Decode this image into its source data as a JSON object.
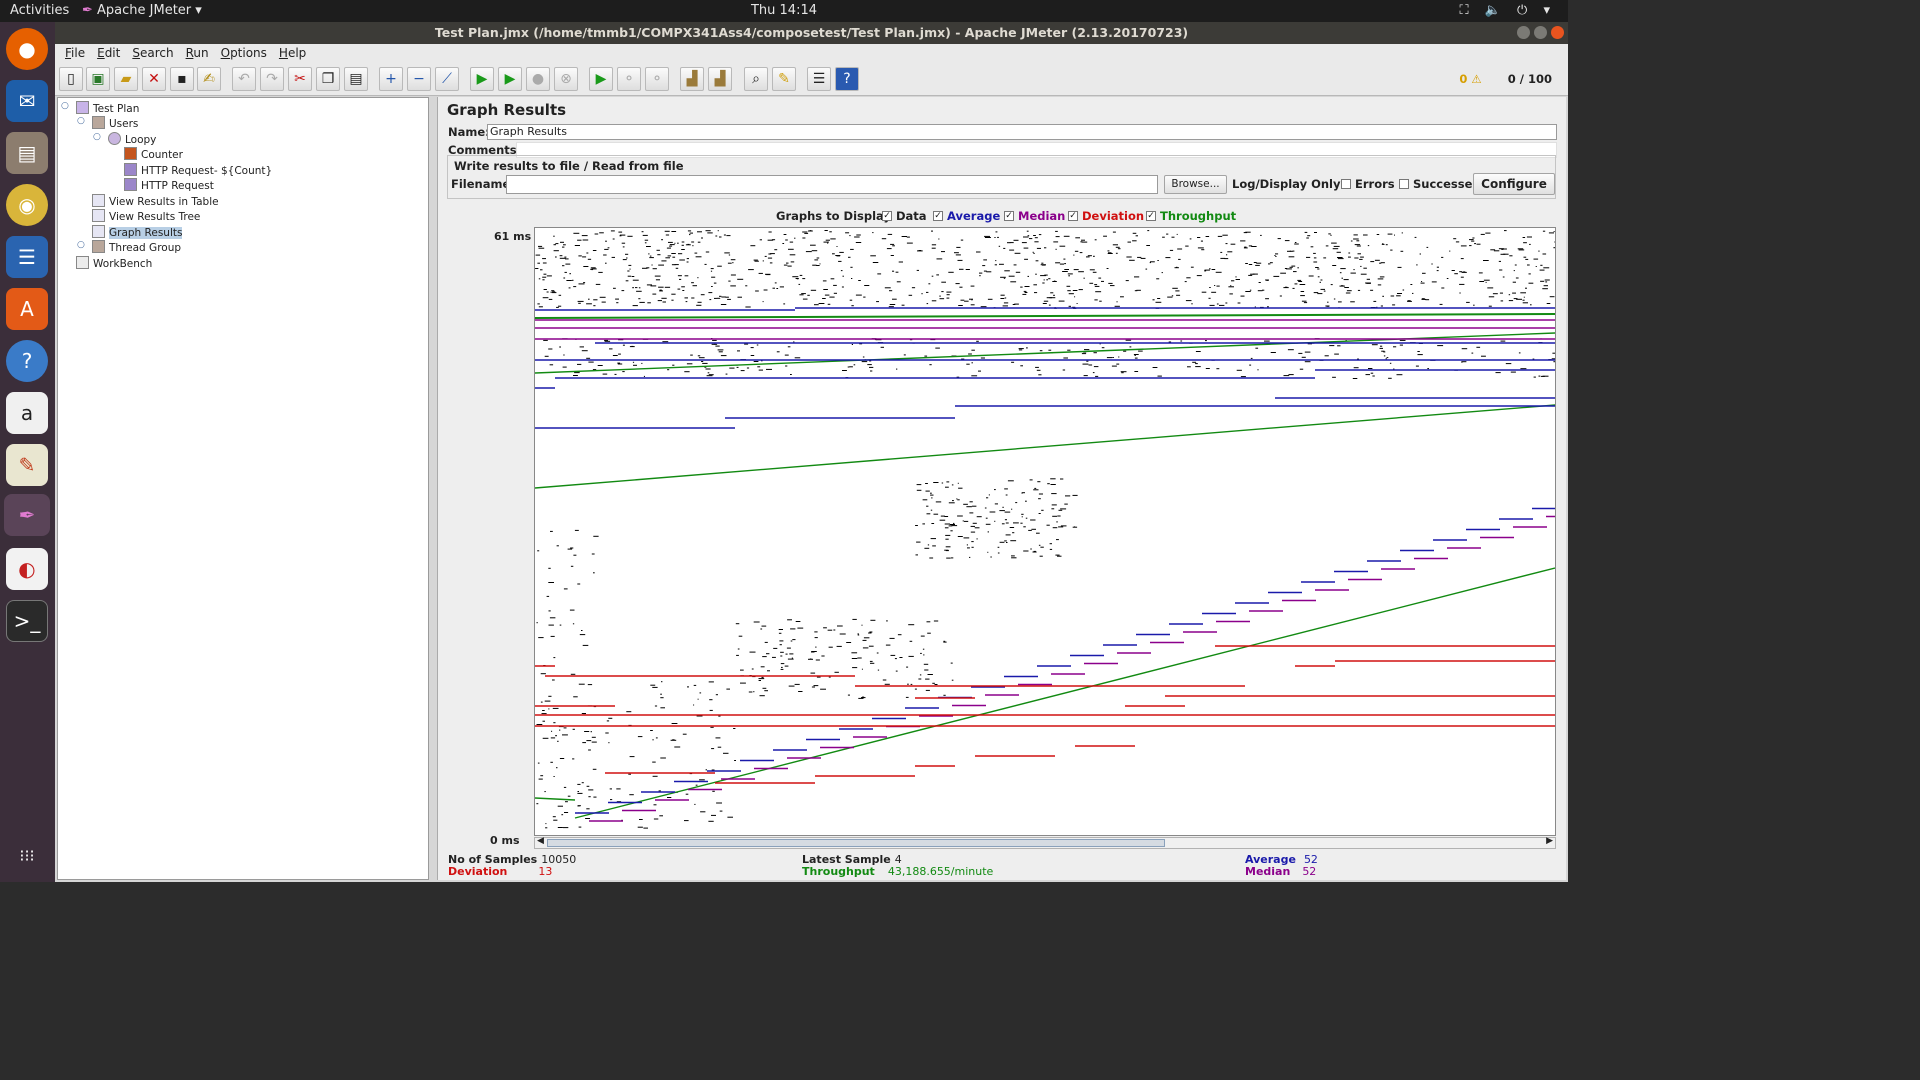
{
  "desktop": {
    "activities": "Activities",
    "app_menu": "Apache JMeter",
    "clock": "Thu 14:14",
    "tray": "⛶ 🔈 ⏻"
  },
  "window": {
    "title": "Test Plan.jmx (/home/tmmb1/COMPX341Ass4/composetest/Test Plan.jmx) - Apache JMeter (2.13.20170723)"
  },
  "menu": [
    "File",
    "Edit",
    "Search",
    "Run",
    "Options",
    "Help"
  ],
  "toolbar": {
    "warnings": "0 ⚠",
    "threads": "0 / 100"
  },
  "tree": [
    {
      "label": "Test Plan",
      "depth": 0
    },
    {
      "label": "Users",
      "depth": 1
    },
    {
      "label": "Loopy",
      "depth": 2
    },
    {
      "label": "Counter",
      "depth": 3
    },
    {
      "label": "HTTP Request- ${Count}",
      "depth": 3
    },
    {
      "label": "HTTP Request",
      "depth": 3
    },
    {
      "label": "View Results in Table",
      "depth": 1
    },
    {
      "label": "View Results Tree",
      "depth": 1
    },
    {
      "label": "Graph Results",
      "depth": 1,
      "selected": true
    },
    {
      "label": "Thread Group",
      "depth": 1
    },
    {
      "label": "WorkBench",
      "depth": 0
    }
  ],
  "panel": {
    "title": "Graph Results",
    "name_label": "Name:",
    "name_value": "Graph Results",
    "comments_label": "Comments:",
    "comments_value": "",
    "file_group_label": "Write results to file / Read from file",
    "filename_label": "Filename",
    "filename_value": "",
    "browse_button": "Browse...",
    "log_display_label": "Log/Display Only:",
    "errors_label": "Errors",
    "successes_label": "Successes",
    "configure_button": "Configure"
  },
  "graphs_to_display": {
    "label": "Graphs to Display",
    "items": [
      {
        "label": "Data",
        "checked": true,
        "color": "#000000"
      },
      {
        "label": "Average",
        "checked": true,
        "color": "#1a1aaa"
      },
      {
        "label": "Median",
        "checked": true,
        "color": "#8b008b"
      },
      {
        "label": "Deviation",
        "checked": true,
        "color": "#d01010"
      },
      {
        "label": "Throughput",
        "checked": true,
        "color": "#128a12"
      }
    ]
  },
  "chart_data": {
    "type": "scatter",
    "ylabel_max": "61 ms",
    "ylabel_min": "0 ms",
    "ylim": [
      0,
      61
    ],
    "legend": "none",
    "grid": false,
    "series": [
      {
        "name": "Data",
        "color": "#000000"
      },
      {
        "name": "Average",
        "color": "#1a1aaa"
      },
      {
        "name": "Median",
        "color": "#8b008b"
      },
      {
        "name": "Deviation",
        "color": "#d01010"
      },
      {
        "name": "Throughput",
        "color": "#128a12"
      }
    ]
  },
  "stats": {
    "samples_label": "No of Samples",
    "samples_value": "10050",
    "deviation_label": "Deviation",
    "deviation_value": "13",
    "latest_label": "Latest Sample",
    "latest_value": "4",
    "throughput_label": "Throughput",
    "throughput_value": "43,188.655/minute",
    "average_label": "Average",
    "average_value": "52",
    "median_label": "Median",
    "median_value": "52"
  },
  "colors": {
    "deviation": "#d01010",
    "throughput": "#128a12",
    "average": "#1a1aaa",
    "median": "#8b008b"
  }
}
